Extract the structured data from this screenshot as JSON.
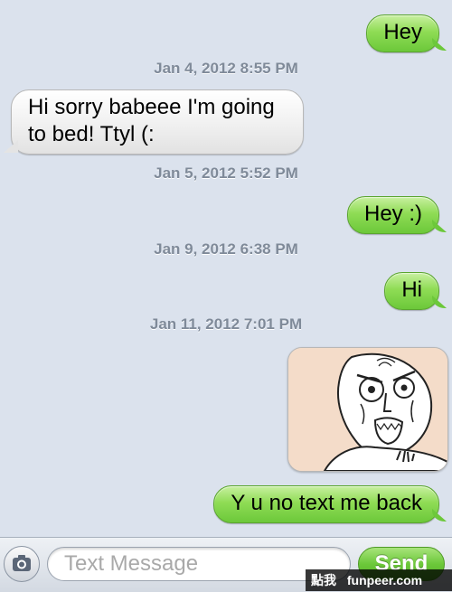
{
  "conversation": {
    "messages": [
      {
        "type": "outgoing",
        "text": "Hey"
      },
      {
        "type": "timestamp",
        "text": "Jan 4, 2012 8:55 PM"
      },
      {
        "type": "incoming",
        "text": "Hi sorry babeee I'm going to bed! Ttyl (:"
      },
      {
        "type": "timestamp",
        "text": "Jan 5, 2012 5:52 PM"
      },
      {
        "type": "outgoing",
        "text": "Hey :)"
      },
      {
        "type": "timestamp",
        "text": "Jan 9, 2012 6:38 PM"
      },
      {
        "type": "outgoing",
        "text": "Hi"
      },
      {
        "type": "timestamp",
        "text": "Jan 11, 2012 7:01 PM"
      },
      {
        "type": "outgoing-image",
        "image": "y-u-no-rage-face"
      },
      {
        "type": "outgoing",
        "text": "Y u no text me back"
      }
    ]
  },
  "input_bar": {
    "camera_icon": "camera-icon",
    "placeholder": "Text Message",
    "send_label": "Send"
  },
  "watermark": {
    "chinese_text": "點我",
    "domain": "funpeer.com"
  },
  "colors": {
    "background": "#dbe2ed",
    "outgoing_bubble": "#6cc83a",
    "incoming_bubble": "#f0f0f0",
    "timestamp_text": "#7f8a99"
  }
}
